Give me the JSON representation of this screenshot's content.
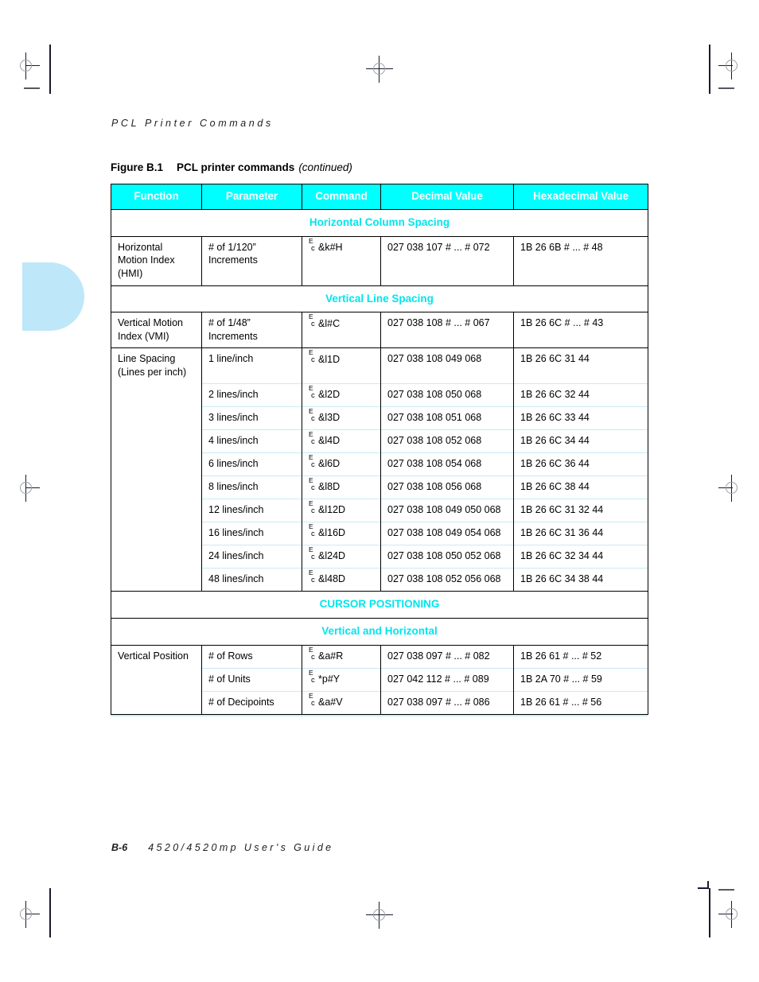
{
  "page": {
    "running_head": "PCL Printer Commands",
    "footer_page": "B-6",
    "footer_book": "4520/4520mp User's Guide",
    "accent_cyan": "#00FFFF",
    "tab_color": "#BEE8F9",
    "separator_color": "#C9EAF7"
  },
  "figure": {
    "label": "Figure B.1",
    "title": "PCL printer commands",
    "continued": "(continued)"
  },
  "table": {
    "columns": [
      "Function",
      "Parameter",
      "Command",
      "Decimal Value",
      "Hexadecimal Value"
    ],
    "sections": [
      {
        "heading": "Horizontal Column Spacing",
        "rows": [
          {
            "function": "Horizontal Motion Index (HMI)",
            "parameter": "# of 1/120” Increments",
            "command_prefix": "Ec",
            "command": "&k#H",
            "decimal": "027 038 107 # ... # 072",
            "hex": "1B 26 6B # ... # 48"
          }
        ]
      },
      {
        "heading": "Vertical Line Spacing",
        "rows": [
          {
            "function": "Vertical Motion Index (VMI)",
            "parameter": "# of 1/48” Increments",
            "command_prefix": "Ec",
            "command": "&l#C",
            "decimal": "027 038 108 # ... # 067",
            "hex": "1B 26 6C # ... # 43"
          },
          {
            "function": "Line Spacing (Lines per inch)",
            "parameter": "1 line/inch",
            "command_prefix": "Ec",
            "command": "&l1D",
            "decimal": "027 038 108 049 068",
            "hex": "1B 26 6C 31 44"
          },
          {
            "function": "",
            "parameter": "2 lines/inch",
            "command_prefix": "Ec",
            "command": "&l2D",
            "decimal": "027 038 108 050 068",
            "hex": "1B 26 6C 32 44"
          },
          {
            "function": "",
            "parameter": "3 lines/inch",
            "command_prefix": "Ec",
            "command": "&l3D",
            "decimal": "027 038 108 051 068",
            "hex": "1B 26 6C 33 44"
          },
          {
            "function": "",
            "parameter": "4 lines/inch",
            "command_prefix": "Ec",
            "command": "&l4D",
            "decimal": "027 038 108 052 068",
            "hex": "1B 26 6C 34 44"
          },
          {
            "function": "",
            "parameter": "6 lines/inch",
            "command_prefix": "Ec",
            "command": "&l6D",
            "decimal": "027 038 108 054 068",
            "hex": "1B 26 6C 36 44"
          },
          {
            "function": "",
            "parameter": "8 lines/inch",
            "command_prefix": "Ec",
            "command": "&l8D",
            "decimal": "027 038 108 056 068",
            "hex": "1B 26 6C 38 44"
          },
          {
            "function": "",
            "parameter": "12 lines/inch",
            "command_prefix": "Ec",
            "command": "&l12D",
            "decimal": "027 038 108 049 050 068",
            "hex": "1B 26 6C 31 32 44"
          },
          {
            "function": "",
            "parameter": "16 lines/inch",
            "command_prefix": "Ec",
            "command": "&l16D",
            "decimal": "027 038 108 049 054 068",
            "hex": "1B 26 6C 31 36 44"
          },
          {
            "function": "",
            "parameter": "24 lines/inch",
            "command_prefix": "Ec",
            "command": "&l24D",
            "decimal": "027 038 108 050 052 068",
            "hex": "1B 26 6C 32 34 44"
          },
          {
            "function": "",
            "parameter": "48 lines/inch",
            "command_prefix": "Ec",
            "command": "&l48D",
            "decimal": "027 038 108 052 056 068",
            "hex": "1B 26 6C 34 38 44"
          }
        ]
      },
      {
        "heading": "CURSOR POSITIONING",
        "rows": []
      },
      {
        "heading": "Vertical and Horizontal",
        "rows": [
          {
            "function": "Vertical Position",
            "parameter": "# of Rows",
            "command_prefix": "Ec",
            "command": "&a#R",
            "decimal": "027 038 097 # ... # 082",
            "hex": "1B 26 61 # ... # 52"
          },
          {
            "function": "",
            "parameter": "# of Units",
            "command_prefix": "Ec",
            "command": "*p#Y",
            "decimal": "027 042 112 # ... # 089",
            "hex": "1B 2A 70 # ... # 59"
          },
          {
            "function": "",
            "parameter": "# of Decipoints",
            "command_prefix": "Ec",
            "command": "&a#V",
            "decimal": "027 038 097 # ... # 086",
            "hex": "1B 26 61 # ... # 56"
          }
        ]
      }
    ]
  }
}
